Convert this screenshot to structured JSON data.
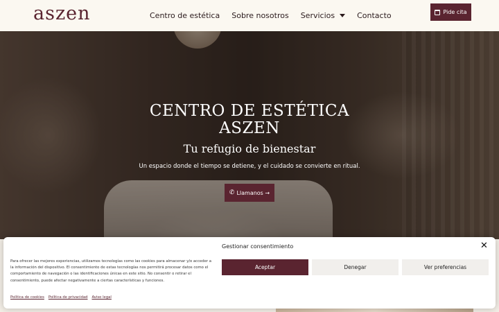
{
  "header": {
    "logo": "aszen",
    "nav": [
      {
        "label": "Centro de estética"
      },
      {
        "label": "Sobre nosotros"
      },
      {
        "label": "Servicios"
      },
      {
        "label": "Contacto"
      }
    ],
    "cta_label": "Pide cita"
  },
  "hero": {
    "title_line1": "CENTRO DE ESTÉTICA",
    "title_line2": "ASZEN",
    "subtitle": "Tu refugio de bienestar",
    "text": "Un espacio donde el tiempo se detiene, y el cuidado se convierte en ritual.",
    "call_label": "Llamanos →"
  },
  "cookie": {
    "title": "Gestionar consentimiento",
    "text": "Para ofrecer las mejores experiencias, utilizamos tecnologías como las cookies para almacenar y/o acceder a la información del dispositivo. El consentimiento de estas tecnologías nos permitirá procesar datos como el comportamiento de navegación o las identificaciones únicas en este sitio. No consentir o retirar el consentimiento, puede afectar negativamente a ciertas características y funciones.",
    "accept": "Aceptar",
    "deny": "Denegar",
    "prefs": "Ver preferencias",
    "links": [
      "Política de cookies",
      "Política de privacidad",
      "Aviso legal"
    ]
  },
  "colors": {
    "brand": "#5a2430",
    "header_bg": "#fbf8f1"
  }
}
